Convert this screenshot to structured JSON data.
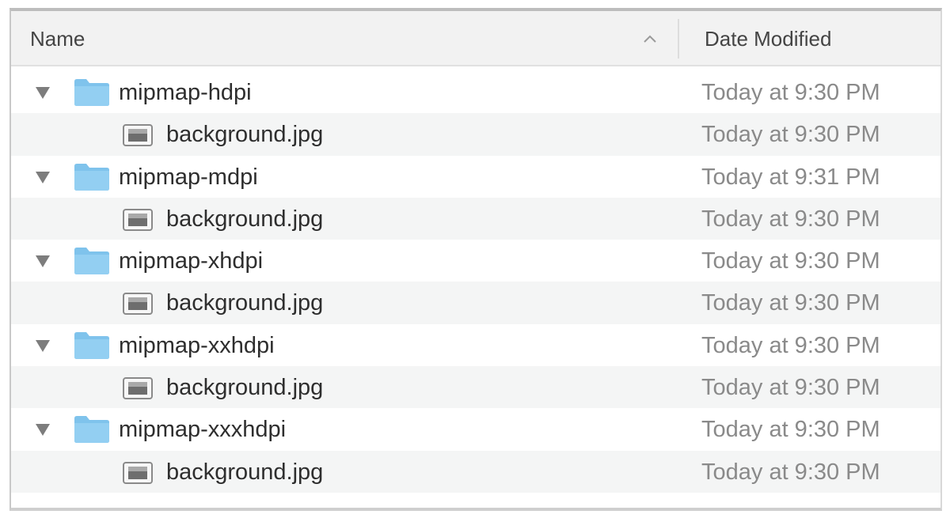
{
  "columns": {
    "name": "Name",
    "date_modified": "Date Modified"
  },
  "colors": {
    "folder": "#8ccbf0",
    "header_bg": "#f2f2f2",
    "stripe": "#f4f5f5",
    "date_text": "#8a8a8a"
  },
  "rows": [
    {
      "kind": "folder",
      "name": "mipmap-hdpi",
      "date": "Today at 9:30 PM",
      "expanded": true,
      "icon": "folder-icon"
    },
    {
      "kind": "file",
      "name": "background.jpg",
      "date": "Today at 9:30 PM",
      "icon": "image-file-icon"
    },
    {
      "kind": "folder",
      "name": "mipmap-mdpi",
      "date": "Today at 9:31 PM",
      "expanded": true,
      "icon": "folder-icon"
    },
    {
      "kind": "file",
      "name": "background.jpg",
      "date": "Today at 9:30 PM",
      "icon": "image-file-icon"
    },
    {
      "kind": "folder",
      "name": "mipmap-xhdpi",
      "date": "Today at 9:30 PM",
      "expanded": true,
      "icon": "folder-icon"
    },
    {
      "kind": "file",
      "name": "background.jpg",
      "date": "Today at 9:30 PM",
      "icon": "image-file-icon"
    },
    {
      "kind": "folder",
      "name": "mipmap-xxhdpi",
      "date": "Today at 9:30 PM",
      "expanded": true,
      "icon": "folder-icon"
    },
    {
      "kind": "file",
      "name": "background.jpg",
      "date": "Today at 9:30 PM",
      "icon": "image-file-icon"
    },
    {
      "kind": "folder",
      "name": "mipmap-xxxhdpi",
      "date": "Today at 9:30 PM",
      "expanded": true,
      "icon": "folder-icon"
    },
    {
      "kind": "file",
      "name": "background.jpg",
      "date": "Today at 9:30 PM",
      "icon": "image-file-icon"
    }
  ]
}
